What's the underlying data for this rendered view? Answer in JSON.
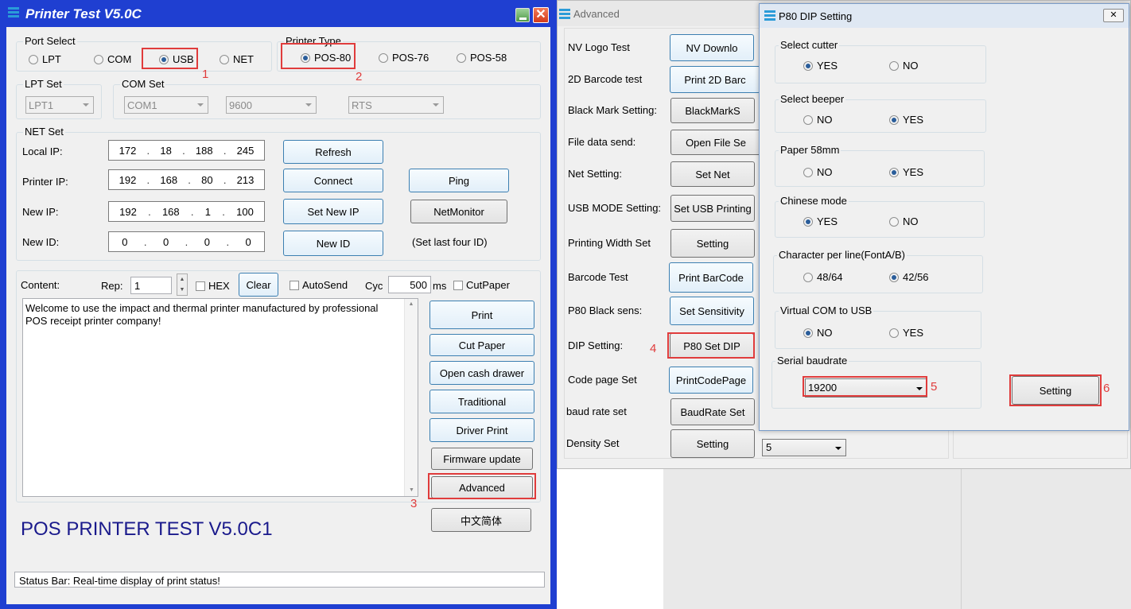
{
  "main": {
    "title": "Printer Test V5.0C",
    "port_select": {
      "label": "Port Select",
      "options": [
        "LPT",
        "COM",
        "USB",
        "NET"
      ],
      "selected": "USB"
    },
    "printer_type": {
      "label": "Printer Type",
      "options": [
        "POS-80",
        "POS-76",
        "POS-58"
      ],
      "selected": "POS-80"
    },
    "lpt_set": {
      "label": "LPT Set",
      "value": "LPT1"
    },
    "com_set": {
      "label": "COM Set",
      "port": "COM1",
      "baud": "9600",
      "flow": "RTS"
    },
    "net_set": {
      "label": "NET Set",
      "local_ip_label": "Local IP:",
      "local_ip": [
        "172",
        "18",
        "188",
        "245"
      ],
      "printer_ip_label": "Printer IP:",
      "printer_ip": [
        "192",
        "168",
        "80",
        "213"
      ],
      "new_ip_label": "New IP:",
      "new_ip": [
        "192",
        "168",
        "1",
        "100"
      ],
      "new_id_label": "New ID:",
      "new_id": [
        "0",
        "0",
        "0",
        "0"
      ],
      "refresh": "Refresh",
      "connect": "Connect",
      "ping": "Ping",
      "set_new_ip": "Set New IP",
      "net_monitor": "NetMonitor",
      "new_id_btn": "New ID",
      "set_last_four": "(Set last four ID)"
    },
    "content": {
      "label": "Content:",
      "rep_label": "Rep:",
      "rep_value": "1",
      "hex": "HEX",
      "clear": "Clear",
      "autosend": "AutoSend",
      "cyc_label": "Cyc",
      "cyc_value": "500",
      "ms": "ms",
      "cutpaper": "CutPaper",
      "text": "Welcome to use the impact and thermal printer manufactured by professional POS receipt printer company!"
    },
    "buttons": {
      "print": "Print",
      "cut_paper": "Cut Paper",
      "open_cash_drawer": "Open cash drawer",
      "traditional": "Traditional",
      "driver_print": "Driver Print",
      "firmware_update": "Firmware update",
      "advanced": "Advanced",
      "chinese": "中文简体"
    },
    "big_title": "POS PRINTER TEST V5.0C1",
    "status": "Status Bar: Real-time display of print status!"
  },
  "advanced": {
    "title": "Advanced",
    "rows": [
      {
        "label": "NV Logo Test",
        "button": "NV Downlo"
      },
      {
        "label": "2D Barcode test",
        "button": "Print 2D Barc"
      },
      {
        "label": "Black Mark Setting:",
        "button": "BlackMarkS"
      },
      {
        "label": "File data send:",
        "button": "Open File Se"
      },
      {
        "label": "Net Setting:",
        "button": "Set Net"
      },
      {
        "label": "USB MODE Setting:",
        "button": "Set USB Printing"
      },
      {
        "label": "Printing Width Set",
        "button": "Setting"
      },
      {
        "label": "Barcode Test",
        "button": "Print BarCode"
      },
      {
        "label": "P80 Black sens:",
        "button": "Set Sensitivity"
      },
      {
        "label": "DIP Setting:",
        "button": "P80 Set DIP"
      },
      {
        "label": "Code page Set",
        "button": "PrintCodePage"
      },
      {
        "label": "baud rate set",
        "button": "BaudRate Set"
      },
      {
        "label": "Density Set",
        "button": "Setting"
      }
    ],
    "density_value": "5"
  },
  "dip": {
    "title": "P80 DIP Setting",
    "groups": [
      {
        "label": "Select cutter",
        "a": "YES",
        "b": "NO",
        "selected": "a"
      },
      {
        "label": "Select beeper",
        "a": "NO",
        "b": "YES",
        "selected": "b"
      },
      {
        "label": "Paper 58mm",
        "a": "NO",
        "b": "YES",
        "selected": "b"
      },
      {
        "label": "Chinese mode",
        "a": "YES",
        "b": "NO",
        "selected": "a"
      },
      {
        "label": "Character per line(FontA/B)",
        "a": "48/64",
        "b": "42/56",
        "selected": "b"
      },
      {
        "label": "Virtual COM to USB",
        "a": "NO",
        "b": "YES",
        "selected": "a"
      }
    ],
    "baud_label": "Serial baudrate",
    "baud_value": "19200",
    "setting": "Setting"
  },
  "annotations": [
    "1",
    "2",
    "3",
    "4",
    "5",
    "6"
  ],
  "colors": {
    "titlebar": "#1f3fd1",
    "highlight": "#e03c3c",
    "big_title": "#1a1a8c"
  }
}
